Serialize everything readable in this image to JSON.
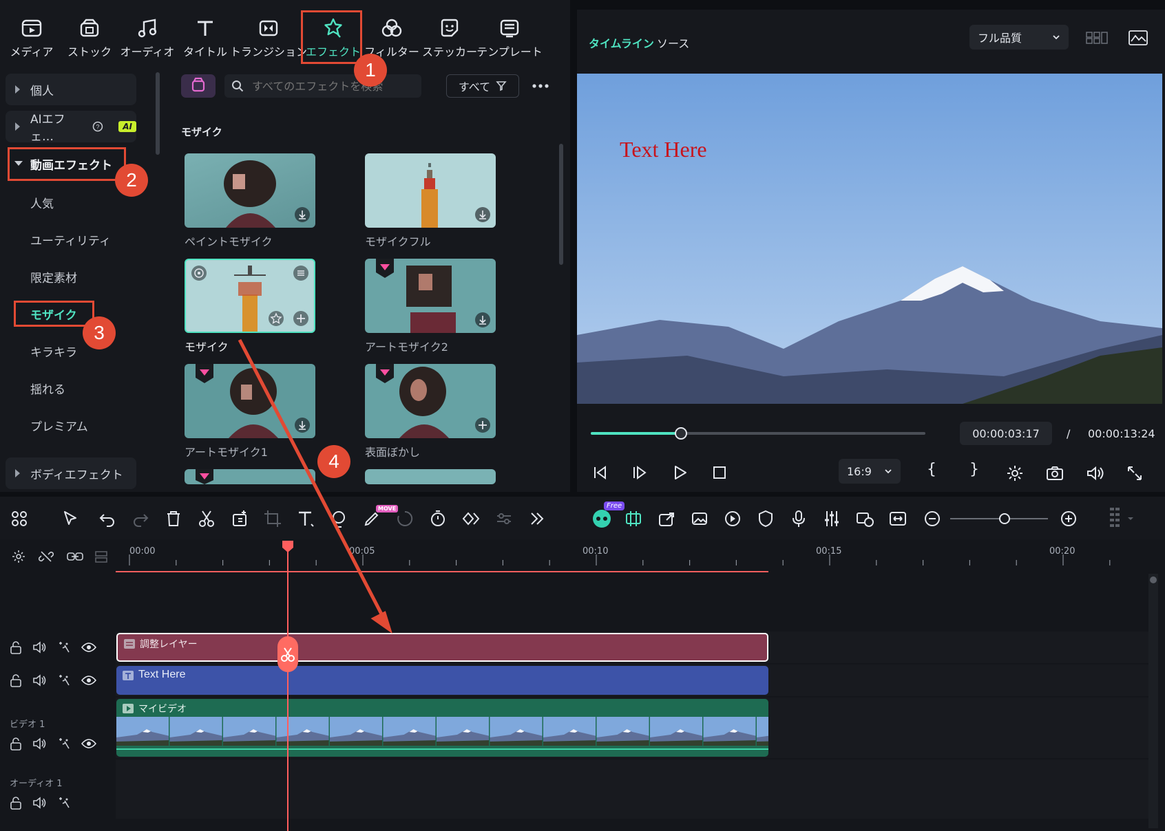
{
  "media_tabs": [
    {
      "label": "メディア",
      "icon": "media-icon"
    },
    {
      "label": "ストック",
      "icon": "stock-icon"
    },
    {
      "label": "オーディオ",
      "icon": "music-note-icon"
    },
    {
      "label": "タイトル",
      "icon": "title-t-icon"
    },
    {
      "label": "トランジション",
      "icon": "transition-icon"
    },
    {
      "label": "エフェクト",
      "icon": "effects-star-icon",
      "active": true
    },
    {
      "label": "フィルター",
      "icon": "filter-icon"
    },
    {
      "label": "ステッカー",
      "icon": "sticker-icon"
    },
    {
      "label": "テンプレート",
      "icon": "template-icon"
    }
  ],
  "sidebar": {
    "groups": [
      {
        "label": "個人",
        "expanded": false
      },
      {
        "label": "AIエフェ…",
        "badge": "AI",
        "expanded": false
      },
      {
        "label": "動画エフェクト",
        "expanded": true
      },
      {
        "label": "ボディエフェクト",
        "expanded": false
      }
    ],
    "subitems": [
      "人気",
      "ユーティリティ",
      "限定素材",
      "モザイク",
      "キラキラ",
      "揺れる",
      "プレミアム"
    ],
    "selected": "モザイク"
  },
  "effects": {
    "search_placeholder": "すべてのエフェクトを検索",
    "filter_label": "すべて",
    "section_title": "モザイク",
    "items": [
      {
        "label": "ペイントモザイク",
        "premium": false,
        "action": "download"
      },
      {
        "label": "モザイクフル",
        "premium": false,
        "action": "download"
      },
      {
        "label": "モザイク",
        "premium": false,
        "action": "add",
        "selected": true
      },
      {
        "label": "アートモザイク2",
        "premium": true,
        "action": "download"
      },
      {
        "label": "アートモザイク1",
        "premium": true,
        "action": "download"
      },
      {
        "label": "表面ぼかし",
        "premium": true,
        "action": "add"
      }
    ]
  },
  "preview": {
    "tab_timeline": "タイムライン",
    "tab_source": "ソース",
    "quality": "フル品質",
    "overlay_text": "Text Here",
    "current_time": "00:00:03:17",
    "separator": "/",
    "total_time": "00:00:13:24",
    "progress_fraction": 0.27,
    "aspect": "16:9",
    "mark_in": "{",
    "mark_out": "}"
  },
  "toolbar": {
    "free_badge": "Free",
    "move_badge": "MOVE"
  },
  "timeline": {
    "ruler_ticks": [
      "00:00",
      "00:05",
      "00:10",
      "00:15",
      "00:20"
    ],
    "tracks": [
      {
        "clip_label": "調整レイヤー",
        "clip_color": "#84394f"
      },
      {
        "clip_label": "Text Here",
        "clip_color": "#3d53a8"
      },
      {
        "track_label": "ビデオ 1",
        "clip_label": "マイビデオ",
        "clip_color": "#1e6b52"
      },
      {
        "track_label": "オーディオ 1"
      }
    ]
  },
  "callouts": [
    "1",
    "2",
    "3",
    "4"
  ],
  "colors": {
    "accent": "#4fe3c1",
    "annotation": "#e24a34",
    "playhead": "#ff5e5e"
  }
}
